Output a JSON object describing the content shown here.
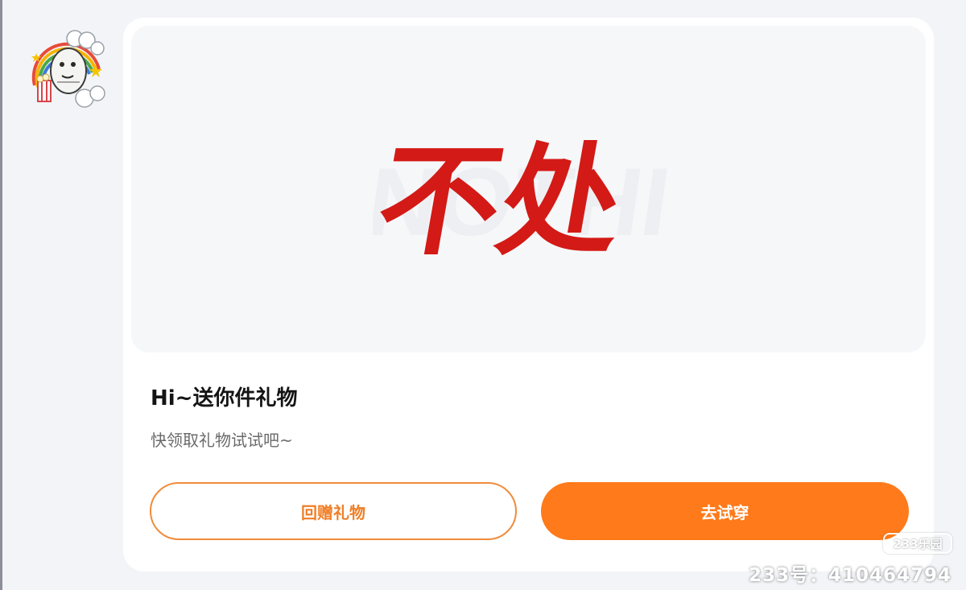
{
  "sender": {
    "avatar_icon": "cartoon-avatar-icon"
  },
  "gift_card": {
    "hero_text": "不处",
    "hero_color": "#d31a16",
    "title": "Hi~送你件礼物",
    "subtitle": "快领取礼物试试吧~"
  },
  "actions": {
    "return_gift_label": "回赠礼物",
    "try_on_label": "去试穿",
    "accent_color": "#ff7a1a"
  },
  "watermark": {
    "logo_text": "233乐园",
    "id_text": "233号：410464794"
  }
}
